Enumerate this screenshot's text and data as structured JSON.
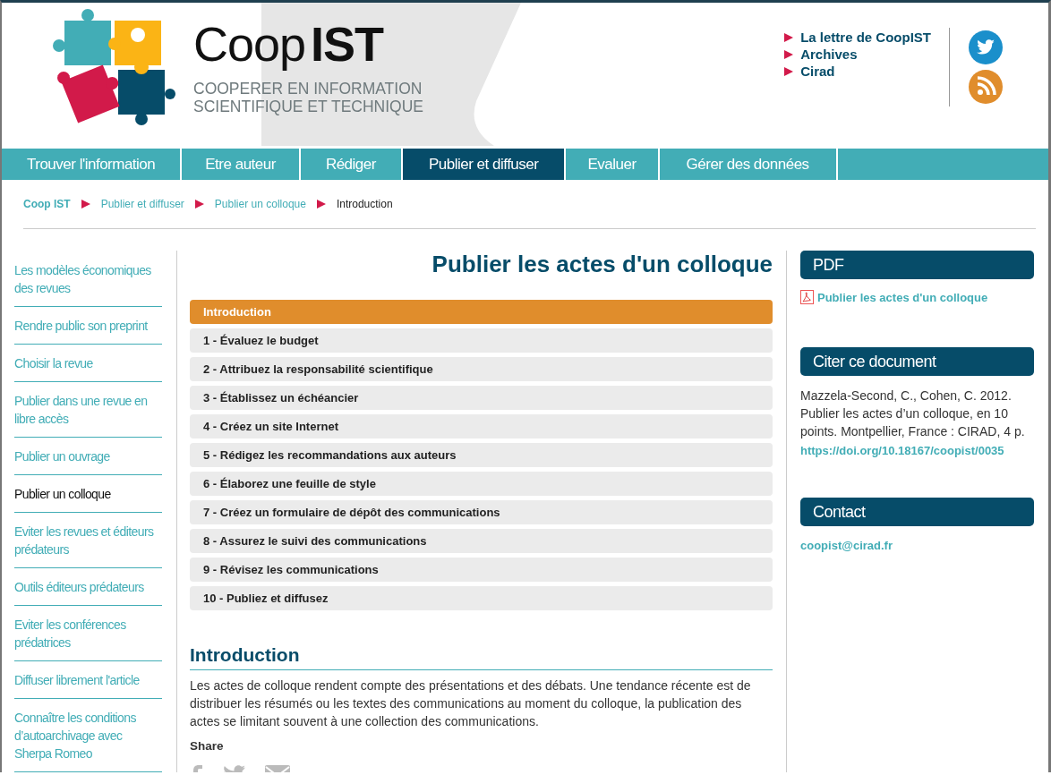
{
  "header": {
    "logo": {
      "word_light": "Coop",
      "word_bold": "IST",
      "tagline": [
        "COOPERER EN INFORMATION",
        "SCIENTIFIQUE ET TECHNIQUE"
      ]
    },
    "top_links": [
      "La lettre de CoopIST",
      "Archives",
      "Cirad"
    ]
  },
  "nav": [
    {
      "label": "Trouver l'information",
      "selected": false
    },
    {
      "label": "Etre auteur",
      "selected": false
    },
    {
      "label": "Rédiger",
      "selected": false
    },
    {
      "label": "Publier et diffuser",
      "selected": true
    },
    {
      "label": "Evaluer",
      "selected": false
    },
    {
      "label": "Gérer des données",
      "selected": false
    }
  ],
  "breadcrumb": [
    {
      "label": "Coop IST",
      "kind": "home"
    },
    {
      "label": "Publier et diffuser",
      "kind": "link"
    },
    {
      "label": "Publier un colloque",
      "kind": "link"
    },
    {
      "label": "Introduction",
      "kind": "current"
    }
  ],
  "sidebar": [
    {
      "label": "Les modèles économiques des revues",
      "selected": false
    },
    {
      "label": "Rendre public son preprint",
      "selected": false
    },
    {
      "label": "Choisir la revue",
      "selected": false
    },
    {
      "label": "Publier dans une revue en libre accès",
      "selected": false
    },
    {
      "label": "Publier un ouvrage",
      "selected": false
    },
    {
      "label": "Publier un colloque",
      "selected": true
    },
    {
      "label": "Eviter les revues et éditeurs prédateurs",
      "selected": false
    },
    {
      "label": "Outils éditeurs prédateurs",
      "selected": false
    },
    {
      "label": "Eviter les conférences prédatrices",
      "selected": false
    },
    {
      "label": "Diffuser librement l'article",
      "selected": false
    },
    {
      "label": "Connaître les conditions d’autoarchivage avec Sherpa Romeo",
      "selected": false
    }
  ],
  "main": {
    "title": "Publier les actes d'un colloque",
    "toc": [
      {
        "label": "Introduction",
        "selected": true
      },
      {
        "label": "1 - Évaluez le budget",
        "selected": false
      },
      {
        "label": "2 - Attribuez la responsabilité scientifique",
        "selected": false
      },
      {
        "label": "3 - Établissez un échéancier",
        "selected": false
      },
      {
        "label": "4 - Créez un site Internet",
        "selected": false
      },
      {
        "label": "5 - Rédigez les recommandations aux auteurs",
        "selected": false
      },
      {
        "label": "6 - Élaborez une feuille de style",
        "selected": false
      },
      {
        "label": "7 - Créez un formulaire de dépôt des communications",
        "selected": false
      },
      {
        "label": "8 - Assurez le suivi des communications",
        "selected": false
      },
      {
        "label": "9 - Révisez les communications",
        "selected": false
      },
      {
        "label": "10 - Publiez et diffusez",
        "selected": false
      }
    ],
    "section_title": "Introduction",
    "paragraph": "Les actes de colloque rendent compte des présentations et des débats. Une tendance récente est de distribuer les résumés ou les textes des communications au moment du colloque, la publication des actes se limitant souvent à une collection des communications.",
    "share_label": "Share"
  },
  "panels": [
    {
      "kind": "pdf",
      "title": "PDF",
      "link": "Publier les actes d'un colloque"
    },
    {
      "kind": "citation",
      "title": "Citer ce document",
      "text": "Mazzela-Second, C., Cohen, C. 2012. Publier les actes d’un colloque, en 10 points. Montpellier, France : CIRAD, 4 p.",
      "link": "https://doi.org/10.18167/coopist/0035"
    },
    {
      "kind": "contact",
      "title": "Contact",
      "link": "coopist@cirad.fr"
    }
  ]
}
